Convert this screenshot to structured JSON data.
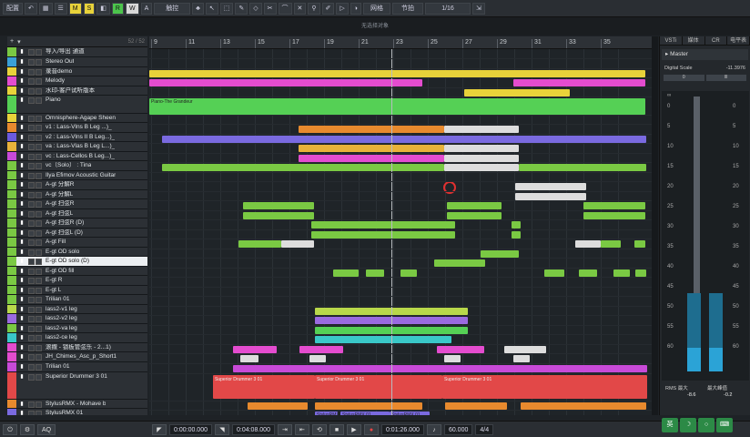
{
  "toolbar": {
    "config": "配置",
    "btn_m": "M",
    "btn_s": "S",
    "btn_r": "R",
    "btn_w": "W",
    "btn_a": "A",
    "touch_mode": "触控",
    "snap_mode": "网格",
    "grid_type": "节拍",
    "quantize": "1/16"
  },
  "subtitle": "无选择对象",
  "tracklist_header": {
    "count": "52 / 52"
  },
  "tracks": [
    {
      "name": "导入/导出 通道",
      "color": "#7ac943"
    },
    {
      "name": "Stereo Out",
      "color": "#3aa0d8"
    },
    {
      "name": "录音demo",
      "color": "#e8d23a"
    },
    {
      "name": "Melody",
      "color": "#e44ccf"
    },
    {
      "name": "水印-客户试听版本",
      "color": "#e8d23a"
    },
    {
      "name": "Piano",
      "color": "#55d055"
    },
    {
      "name": "Omnisphere-Agape Sheen",
      "color": "#e8d23a"
    },
    {
      "name": "v1 : Lass-Vlns B Leg ...)_",
      "color": "#e88a2e"
    },
    {
      "name": "v2 : Lass-Vlns II B Leg...)_",
      "color": "#6b5ae0"
    },
    {
      "name": "va : Lass-Vlas B Leg L...)_",
      "color": "#e8b23a"
    },
    {
      "name": "vc : Lass-Cellos B Leg...)_",
      "color": "#c84ad8"
    },
    {
      "name": "vc（Solo） : Tina",
      "color": "#7ac943"
    },
    {
      "name": "Ilya Efimov Acoustic Guitar",
      "color": "#7ac943"
    },
    {
      "name": "A-gt 分解R",
      "color": "#7ac943"
    },
    {
      "name": "A-gt 分解L",
      "color": "#7ac943"
    },
    {
      "name": "A-gt 扫弦R",
      "color": "#7ac943"
    },
    {
      "name": "A-gt 扫弦L",
      "color": "#7ac943"
    },
    {
      "name": "A-gt 扫弦R (D)",
      "color": "#7ac943"
    },
    {
      "name": "A-gt 扫弦L (D)",
      "color": "#7ac943"
    },
    {
      "name": "A-gt Fill",
      "color": "#7ac943"
    },
    {
      "name": "E-gt OD solo",
      "color": "#7ac943"
    },
    {
      "name": "E-gt OD solo (D)",
      "color": "#7ac943"
    },
    {
      "name": "E-gt OD fill",
      "color": "#7ac943"
    },
    {
      "name": "E-gt R",
      "color": "#7ac943"
    },
    {
      "name": "E-gt L",
      "color": "#7ac943"
    },
    {
      "name": "Trilian 01",
      "color": "#7ac943"
    },
    {
      "name": "lass2-v1 leg",
      "color": "#b8d84a"
    },
    {
      "name": "lass2-v2 leg",
      "color": "#9a6ae0"
    },
    {
      "name": "lass2-va leg",
      "color": "#7ac943"
    },
    {
      "name": "lass2-ce leg",
      "color": "#3ac8c8"
    },
    {
      "name": "滚撒 - 锁板管弦乐 - 2...1)",
      "color": "#e44ccf"
    },
    {
      "name": "JH_Chimes_Asc_p_Short1",
      "color": "#e44ccf"
    },
    {
      "name": "Trilian 01",
      "color": "#c84ad8"
    },
    {
      "name": "Superior Drummer 3 01",
      "color": "#e24848"
    },
    {
      "name": "StylusRMX - Mohave b",
      "color": "#e88a2e"
    },
    {
      "name": "StylusRMX 01",
      "color": "#7a6ae0"
    }
  ],
  "ruler": [
    "9",
    "11",
    "13",
    "15",
    "17",
    "19",
    "21",
    "23",
    "25",
    "27",
    "29",
    "31",
    "33",
    "35"
  ],
  "clips": [
    {
      "label": "Piano-The Grandeur",
      "color": "#55d055"
    },
    {
      "label": "Superior Drummer 3 01",
      "color": "#e24848"
    },
    {
      "label": "Superior Drummer 3 01",
      "color": "#e24848"
    },
    {
      "label": "Superior Drummer 3 01",
      "color": "#e24848"
    },
    {
      "label": "StylusRMX 01",
      "color": "#7a6ae0"
    },
    {
      "label": "StylusRMX 01",
      "color": "#7a6ae0"
    },
    {
      "label": "StylusRMX 01",
      "color": "#7a6ae0"
    }
  ],
  "inspector": {
    "tabs": [
      "VSTi",
      "媒体",
      "CR",
      "电平表"
    ],
    "master": "Master",
    "digital_scale": "Digital Scale",
    "scale_value": "-11.3976",
    "ctrl_left": "0",
    "ctrl_right": "lll",
    "scale_left": [
      "0",
      "5",
      "10",
      "15",
      "20",
      "25",
      "30",
      "35",
      "40",
      "45",
      "50",
      "55",
      "60"
    ],
    "scale_right": [
      "0",
      "5",
      "10",
      "15",
      "20",
      "25",
      "30",
      "35",
      "40",
      "45",
      "50",
      "55",
      "60"
    ],
    "scale_top": "∞",
    "meter_levels": {
      "left": 0.08,
      "right": 0.08
    },
    "rms_label": "RMS 最大",
    "peak_label": "最大峰值",
    "rms_value": "-8.6",
    "peak_value": "-0.2"
  },
  "transport": {
    "pos_start": "0:00:00.000",
    "pos_end": "0:04:08.000",
    "pos_current": "0:01:26.000",
    "tempo": "60.000",
    "signature": "4/4"
  },
  "tray": [
    "英",
    "☽",
    "○",
    "⌨"
  ]
}
